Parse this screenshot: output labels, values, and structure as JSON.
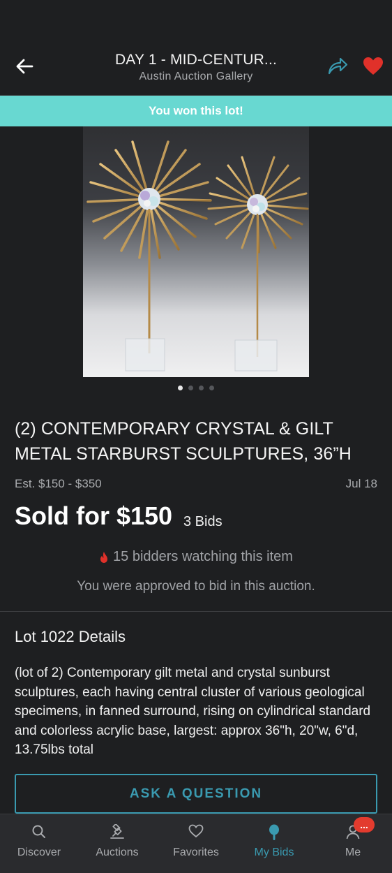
{
  "header": {
    "title": "DAY 1 - MID-CENTUR...",
    "subtitle": "Austin Auction Gallery",
    "back_icon": "arrow-left-icon",
    "share_icon": "share-icon",
    "favorite_icon": "heart-icon",
    "favorite_color": "#e0312a",
    "share_color": "#3a9ab0"
  },
  "banner": {
    "text": "You won this lot!",
    "color": "#68d8d1"
  },
  "gallery": {
    "image_count": 4,
    "active_index": 0
  },
  "lot": {
    "title": "(2) CONTEMPORARY CRYSTAL & GILT METAL STARBURST SCULPTURES, 36”H",
    "estimate": "Est. $150 - $350",
    "date": "Jul 18",
    "sold": "Sold for $150",
    "bids": "3 Bids",
    "watching": "15 bidders watching this item",
    "approved": "You were approved to bid in this auction."
  },
  "details": {
    "heading": "Lot 1022 Details",
    "body": "(lot of 2) Contemporary gilt metal and crystal sunburst sculptures, each having central cluster of various geological specimens, in fanned surround, rising on cylindrical standard and colorless acrylic base, largest: approx 36\"h, 20\"w, 6\"d, 13.75lbs total"
  },
  "ask_button": {
    "label": "ASK A QUESTION"
  },
  "tabbar": {
    "tabs": [
      {
        "label": "Discover",
        "icon": "search-icon"
      },
      {
        "label": "Auctions",
        "icon": "gavel-icon"
      },
      {
        "label": "Favorites",
        "icon": "heart-outline-icon"
      },
      {
        "label": "My Bids",
        "icon": "paddle-icon",
        "active": true
      },
      {
        "label": "Me",
        "icon": "person-icon",
        "badge": "..."
      }
    ],
    "active_color": "#3a9ab0"
  }
}
